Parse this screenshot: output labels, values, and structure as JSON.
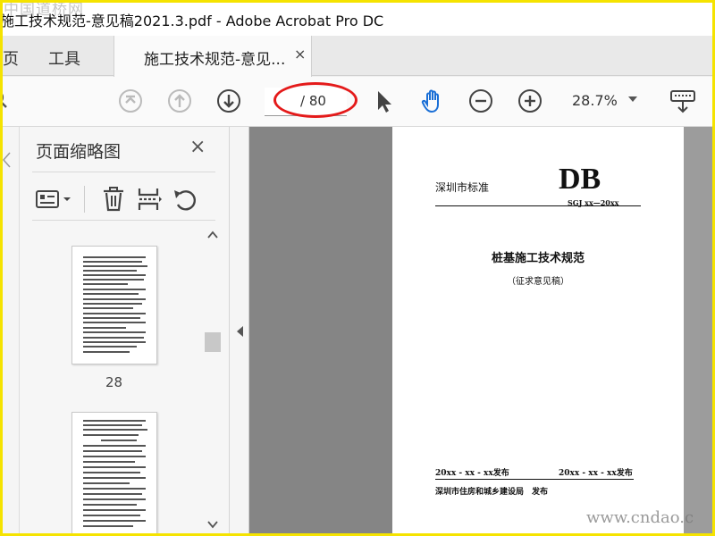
{
  "window": {
    "title": "施工技术规范-意见稿2021.3.pdf - Adobe Acrobat Pro DC"
  },
  "tabs": {
    "home": "页",
    "tools": "工具",
    "document": "施工技术规范-意见...",
    "close_symbol": "×"
  },
  "toolbar": {
    "page_indicator": "/ 80",
    "zoom": "28.7%",
    "icons": [
      "first-page-icon",
      "previous-page-icon",
      "next-page-icon",
      "select-cursor-icon",
      "hand-tool-icon",
      "zoom-out-icon",
      "zoom-in-icon",
      "zoom-dropdown-icon",
      "keyboard-scroll-icon"
    ],
    "accent_color": "#1a6fd6",
    "highlight_oval_color": "#e41a1a"
  },
  "thumbnails_panel": {
    "title": "页面缩略图",
    "close_symbol": "×",
    "tools": [
      "options-menu-icon",
      "delete-page-icon",
      "insert-page-icon",
      "rotate-page-icon"
    ],
    "pages": [
      {
        "number": "28"
      }
    ]
  },
  "document_page": {
    "standard_label": "深圳市标准",
    "code": "DB",
    "standard_number": "SGJ xx—20xx",
    "title": "桩基施工技术规范",
    "subtitle": "（征求意见稿）",
    "publish_left": "20xx - xx - xx发布",
    "publish_right": "20xx - xx - xx发布",
    "issuer": "深圳市住房和城乡建设局　发布"
  },
  "watermarks": {
    "top": "中国道桥网",
    "bottom": "www.cndao.c"
  },
  "frame_color": "#f5e300"
}
